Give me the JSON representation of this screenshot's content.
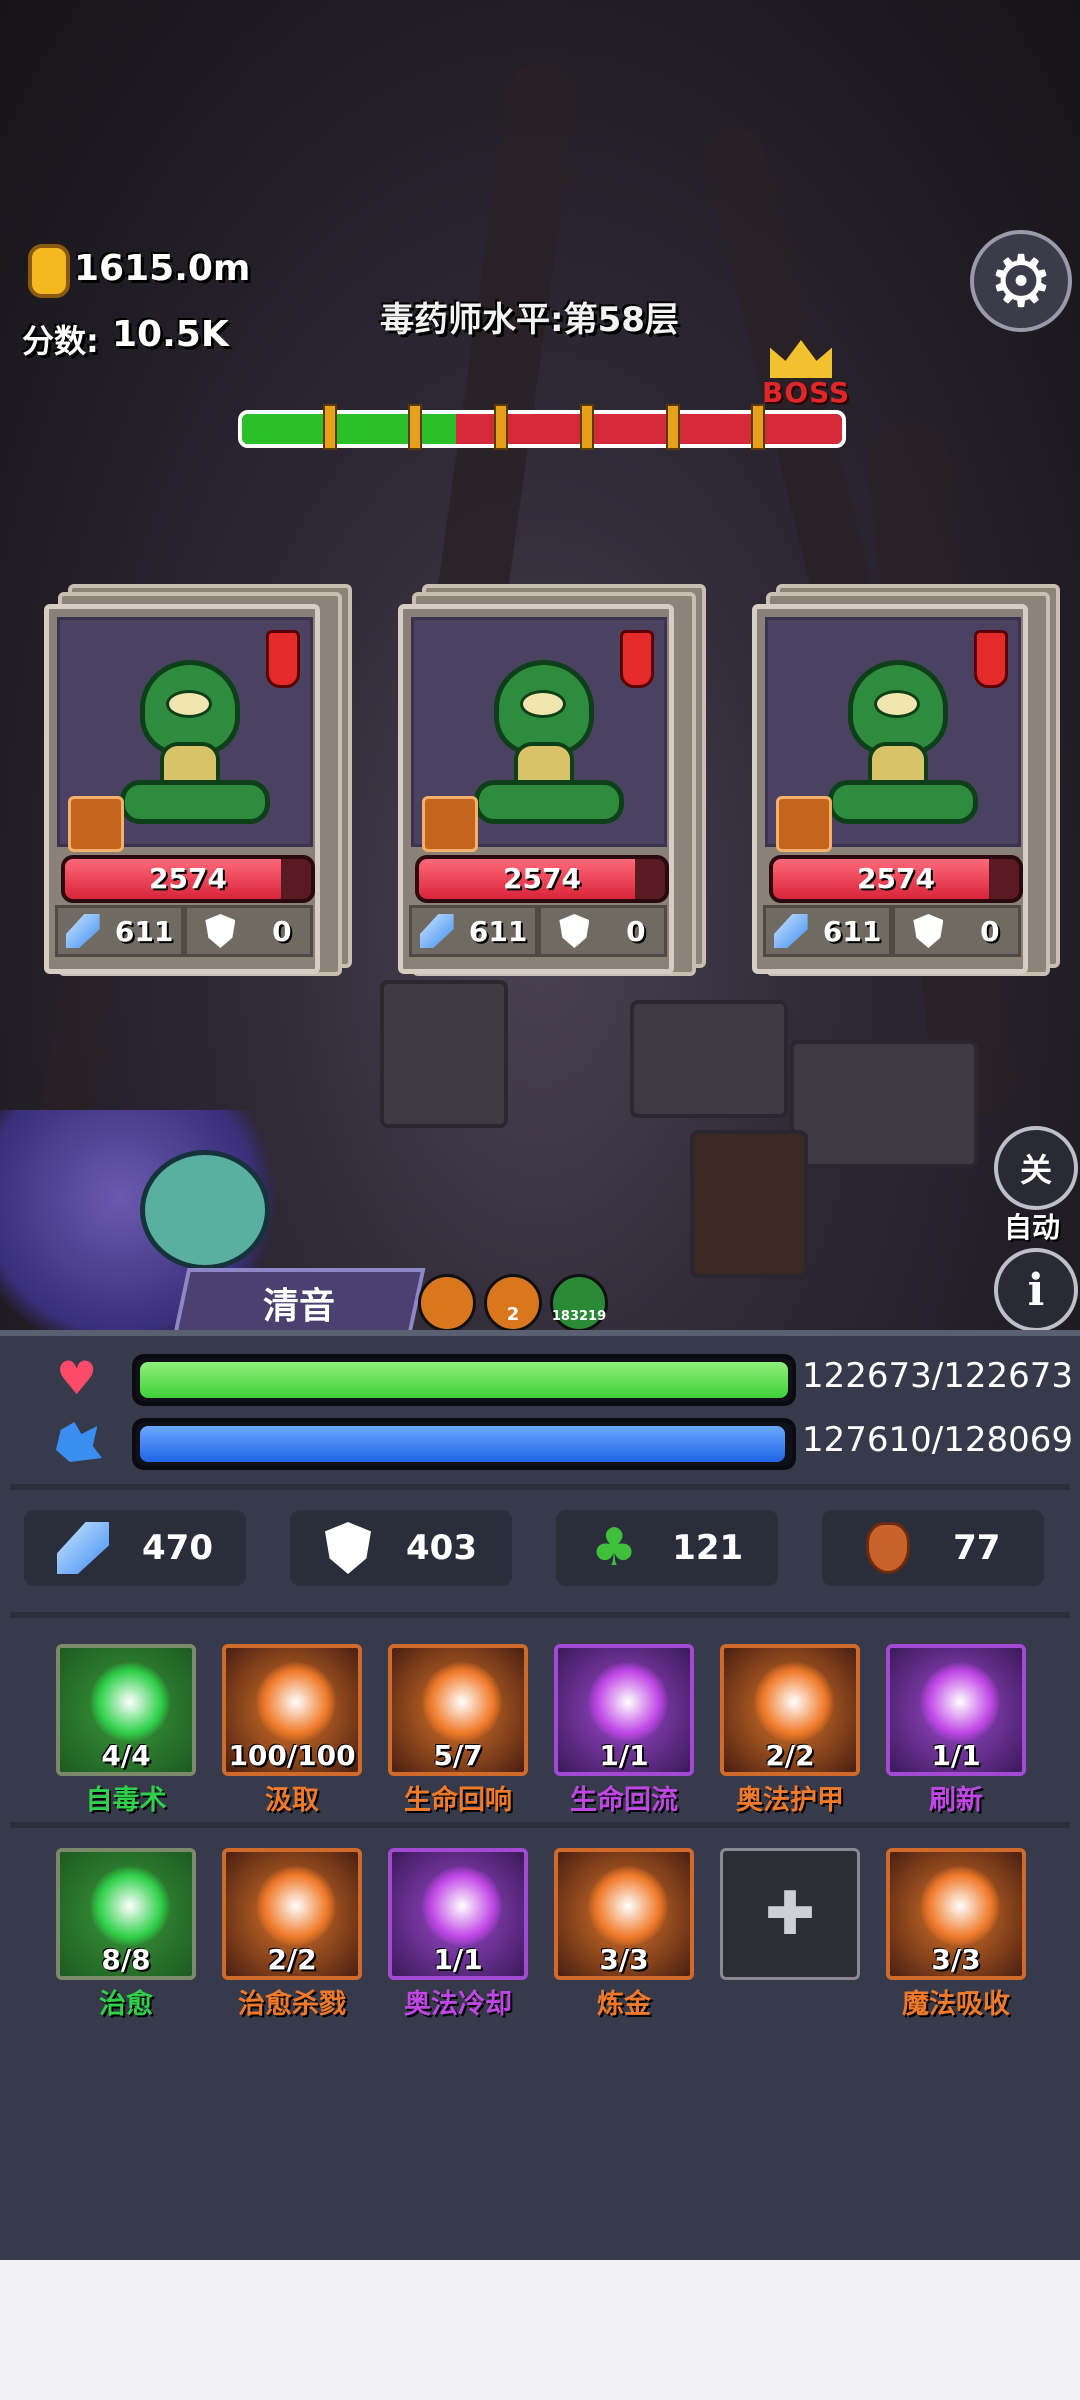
{
  "hud": {
    "gold": "1615.0m",
    "score_label": "分数:",
    "score_value": "10.5K",
    "level_title": "毒药师水平:第58层",
    "boss_label": "BOSS"
  },
  "wave_progress": {
    "segments_total": 7,
    "segments_cleared": 2.5
  },
  "enemies": [
    {
      "hp": "2574",
      "hp_fraction": 0.88,
      "attack": "611",
      "defense": "0"
    },
    {
      "hp": "2574",
      "hp_fraction": 0.88,
      "attack": "611",
      "defense": "0"
    },
    {
      "hp": "2574",
      "hp_fraction": 0.88,
      "attack": "611",
      "defense": "0"
    }
  ],
  "auto": {
    "toggle_label": "关",
    "label": "自动"
  },
  "hero": {
    "name": "清音",
    "buffs": [
      {
        "icon": "meditate-icon",
        "badge": ""
      },
      {
        "icon": "fist-icon",
        "badge": "2"
      },
      {
        "icon": "poison-skull-icon",
        "badge": "183219"
      }
    ]
  },
  "player": {
    "hp_text": "122673/122673",
    "hp_fraction": 1.0,
    "mp_text": "127610/128069",
    "mp_fraction": 0.996,
    "colors": {
      "hp": "#3fcf3a",
      "mp": "#1f64e6"
    }
  },
  "stats": [
    {
      "icon": "sword-icon",
      "value": "470"
    },
    {
      "icon": "shield-icon",
      "value": "403"
    },
    {
      "icon": "clover-icon",
      "value": "121"
    },
    {
      "icon": "money-bag-icon",
      "value": "77"
    }
  ],
  "skills_row1": [
    {
      "name": "自毒术",
      "count": "4/4",
      "color": "#2fd04a",
      "icon": "skull-icon"
    },
    {
      "name": "汲取",
      "count": "100/100",
      "color": "#f07a2a",
      "icon": "drain-icon"
    },
    {
      "name": "生命回响",
      "count": "5/7",
      "color": "#f07a2a",
      "icon": "muscle-icon"
    },
    {
      "name": "生命回流",
      "count": "1/1",
      "color": "#c046e6",
      "icon": "spirit-icon"
    },
    {
      "name": "奥法护甲",
      "count": "2/2",
      "color": "#f07a2a",
      "icon": "arcane-armor-icon"
    },
    {
      "name": "刷新",
      "count": "1/1",
      "color": "#c046e6",
      "icon": "swirl-icon"
    }
  ],
  "skills_row2": [
    {
      "name": "治愈",
      "count": "8/8",
      "color": "#2fd04a",
      "icon": "heal-drop-icon"
    },
    {
      "name": "治愈杀戮",
      "count": "2/2",
      "color": "#f07a2a",
      "icon": "heal-kill-icon"
    },
    {
      "name": "奥法冷却",
      "count": "1/1",
      "color": "#c046e6",
      "icon": "arcane-cooldown-icon"
    },
    {
      "name": "炼金",
      "count": "3/3",
      "color": "#f07a2a",
      "icon": "alchemy-icon"
    },
    {
      "name": "",
      "count": "",
      "color": "",
      "icon": "add-slot-icon"
    },
    {
      "name": "魔法吸收",
      "count": "3/3",
      "color": "#f07a2a",
      "icon": "magic-absorb-icon"
    }
  ]
}
